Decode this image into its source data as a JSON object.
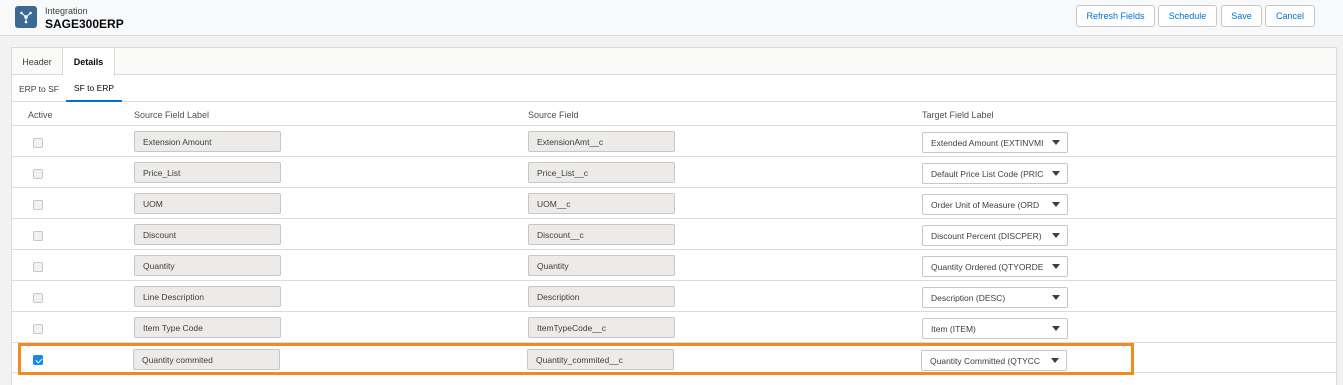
{
  "header": {
    "subtitle": "Integration",
    "title": "SAGE300ERP",
    "buttons": {
      "refresh_fields": "Refresh Fields",
      "schedule": "Schedule",
      "save": "Save",
      "cancel": "Cancel"
    }
  },
  "tabs": [
    "Header",
    "Details"
  ],
  "active_tab": "Details",
  "subtabs": [
    "ERP to SF",
    "SF to ERP"
  ],
  "active_subtab": "SF to ERP",
  "table": {
    "columns": [
      "Active",
      "Source Field Label",
      "Source Field",
      "Target Field Label"
    ],
    "rows": [
      {
        "active": false,
        "source_label": "Extension Amount",
        "source_field": "ExtensionAmt__c",
        "target_label": "Extended Amount (EXTINVMI"
      },
      {
        "active": false,
        "source_label": "Price_List",
        "source_field": "Price_List__c",
        "target_label": "Default Price List Code (PRIC"
      },
      {
        "active": false,
        "source_label": "UOM",
        "source_field": "UOM__c",
        "target_label": "Order Unit of Measure (ORD"
      },
      {
        "active": false,
        "source_label": "Discount",
        "source_field": "Discount__c",
        "target_label": "Discount Percent (DISCPER)"
      },
      {
        "active": false,
        "source_label": "Quantity",
        "source_field": "Quantity",
        "target_label": "Quantity Ordered (QTYORDE"
      },
      {
        "active": false,
        "source_label": "Line Description",
        "source_field": "Description",
        "target_label": "Description (DESC)"
      },
      {
        "active": false,
        "source_label": "Item Type Code",
        "source_field": "ItemTypeCode__c",
        "target_label": "Item (ITEM)"
      },
      {
        "active": true,
        "source_label": "Quantity commited",
        "source_field": "Quantity_commited__c",
        "target_label": "Quantity Committed (QTYCC"
      }
    ]
  },
  "colors": {
    "brand_blue": "#0070d2",
    "checkbox_checked": "#1589ee",
    "highlight_orange": "#f28a22"
  }
}
